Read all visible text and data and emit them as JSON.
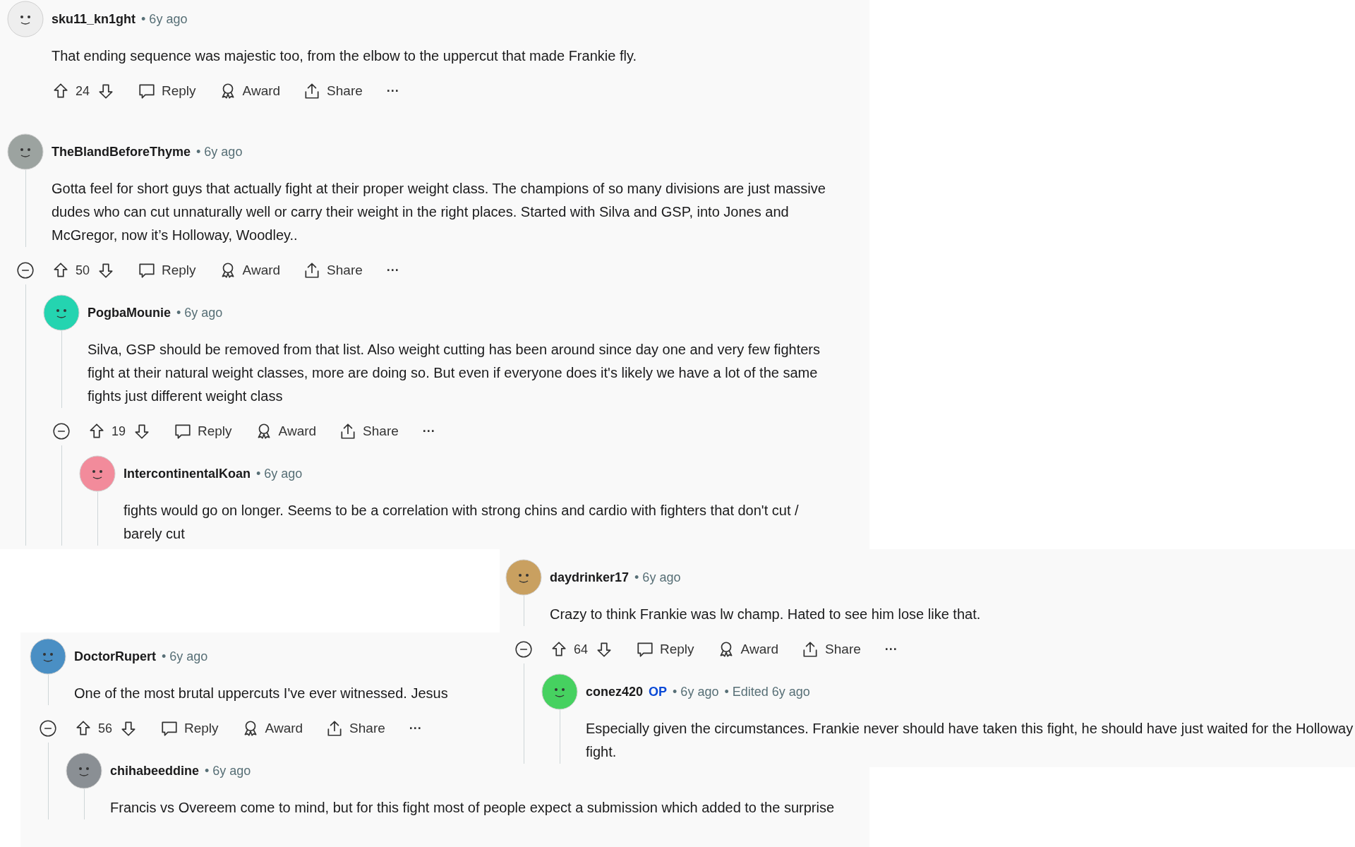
{
  "panels": [
    {
      "comments": [
        {
          "user": "sku11_kn1ght",
          "time": "• 6y ago",
          "color": "#eeeeee",
          "collapsible": false,
          "body": "That ending sequence was majestic too, from the elbow to the uppercut that made Frankie fly.",
          "actions": {
            "votes": "24",
            "reply": "Reply",
            "award": "Award",
            "share": "Share",
            "more": "···"
          }
        },
        {
          "user": "TheBlandBeforeThyme",
          "time": "• 6y ago",
          "color": "#9ca3a0",
          "collapsible": true,
          "body": "Gotta feel for short guys that actually fight at their proper weight class. The champions of so many divisions are just massive dudes who can cut unnaturally well or carry their weight in the right places. Started with Silva and GSP, into Jones and McGregor, now it’s Holloway, Woodley..",
          "actions": {
            "votes": "50",
            "reply": "Reply",
            "award": "Award",
            "share": "Share",
            "more": "···"
          },
          "children": [
            {
              "user": "PogbaMounie",
              "time": "• 6y ago",
              "color": "#24d4b0",
              "collapsible": true,
              "body": "Silva, GSP should be removed from that list. Also weight cutting has been around since day one and very few fighters fight at their natural weight classes, more are doing so. But even if everyone does it's likely we have a lot of the same fights just different weight class",
              "actions": {
                "votes": "19",
                "reply": "Reply",
                "award": "Award",
                "share": "Share",
                "more": "···"
              },
              "children": [
                {
                  "user": "IntercontinentalKoan",
                  "time": "• 6y ago",
                  "color": "#f28b9b",
                  "body": "fights would go on longer. Seems to be a correlation with strong chins and cardio with fighters that don't cut / barely cut"
                }
              ]
            }
          ]
        }
      ]
    },
    {
      "comments": [
        {
          "user": "daydrinker17",
          "time": "• 6y ago",
          "color": "#c9a060",
          "collapsible": true,
          "body": "Crazy to think Frankie was lw champ. Hated to see him lose like that.",
          "actions": {
            "votes": "64",
            "reply": "Reply",
            "award": "Award",
            "share": "Share",
            "more": "···"
          },
          "children": [
            {
              "user": "conez420",
              "op": "OP",
              "time": "• 6y ago",
              "edited": "• Edited 6y ago",
              "color": "#46d160",
              "body": "Especially given the circumstances. Frankie never should have taken this fight, he should have just waited for the Holloway fight."
            }
          ]
        }
      ]
    },
    {
      "comments": [
        {
          "user": "DoctorRupert",
          "time": "• 6y ago",
          "color": "#4a8fc4",
          "collapsible": true,
          "body": "One of the most brutal uppercuts I've ever witnessed. Jesus",
          "actions": {
            "votes": "56",
            "reply": "Reply",
            "award": "Award",
            "share": "Share",
            "more": "···"
          },
          "children": [
            {
              "user": "chihabeeddine",
              "time": "• 6y ago",
              "color": "#8a8f94",
              "body": "Francis vs Overeem come to mind, but for this fight most of people expect a submission which added to the surprise"
            }
          ]
        }
      ]
    }
  ]
}
